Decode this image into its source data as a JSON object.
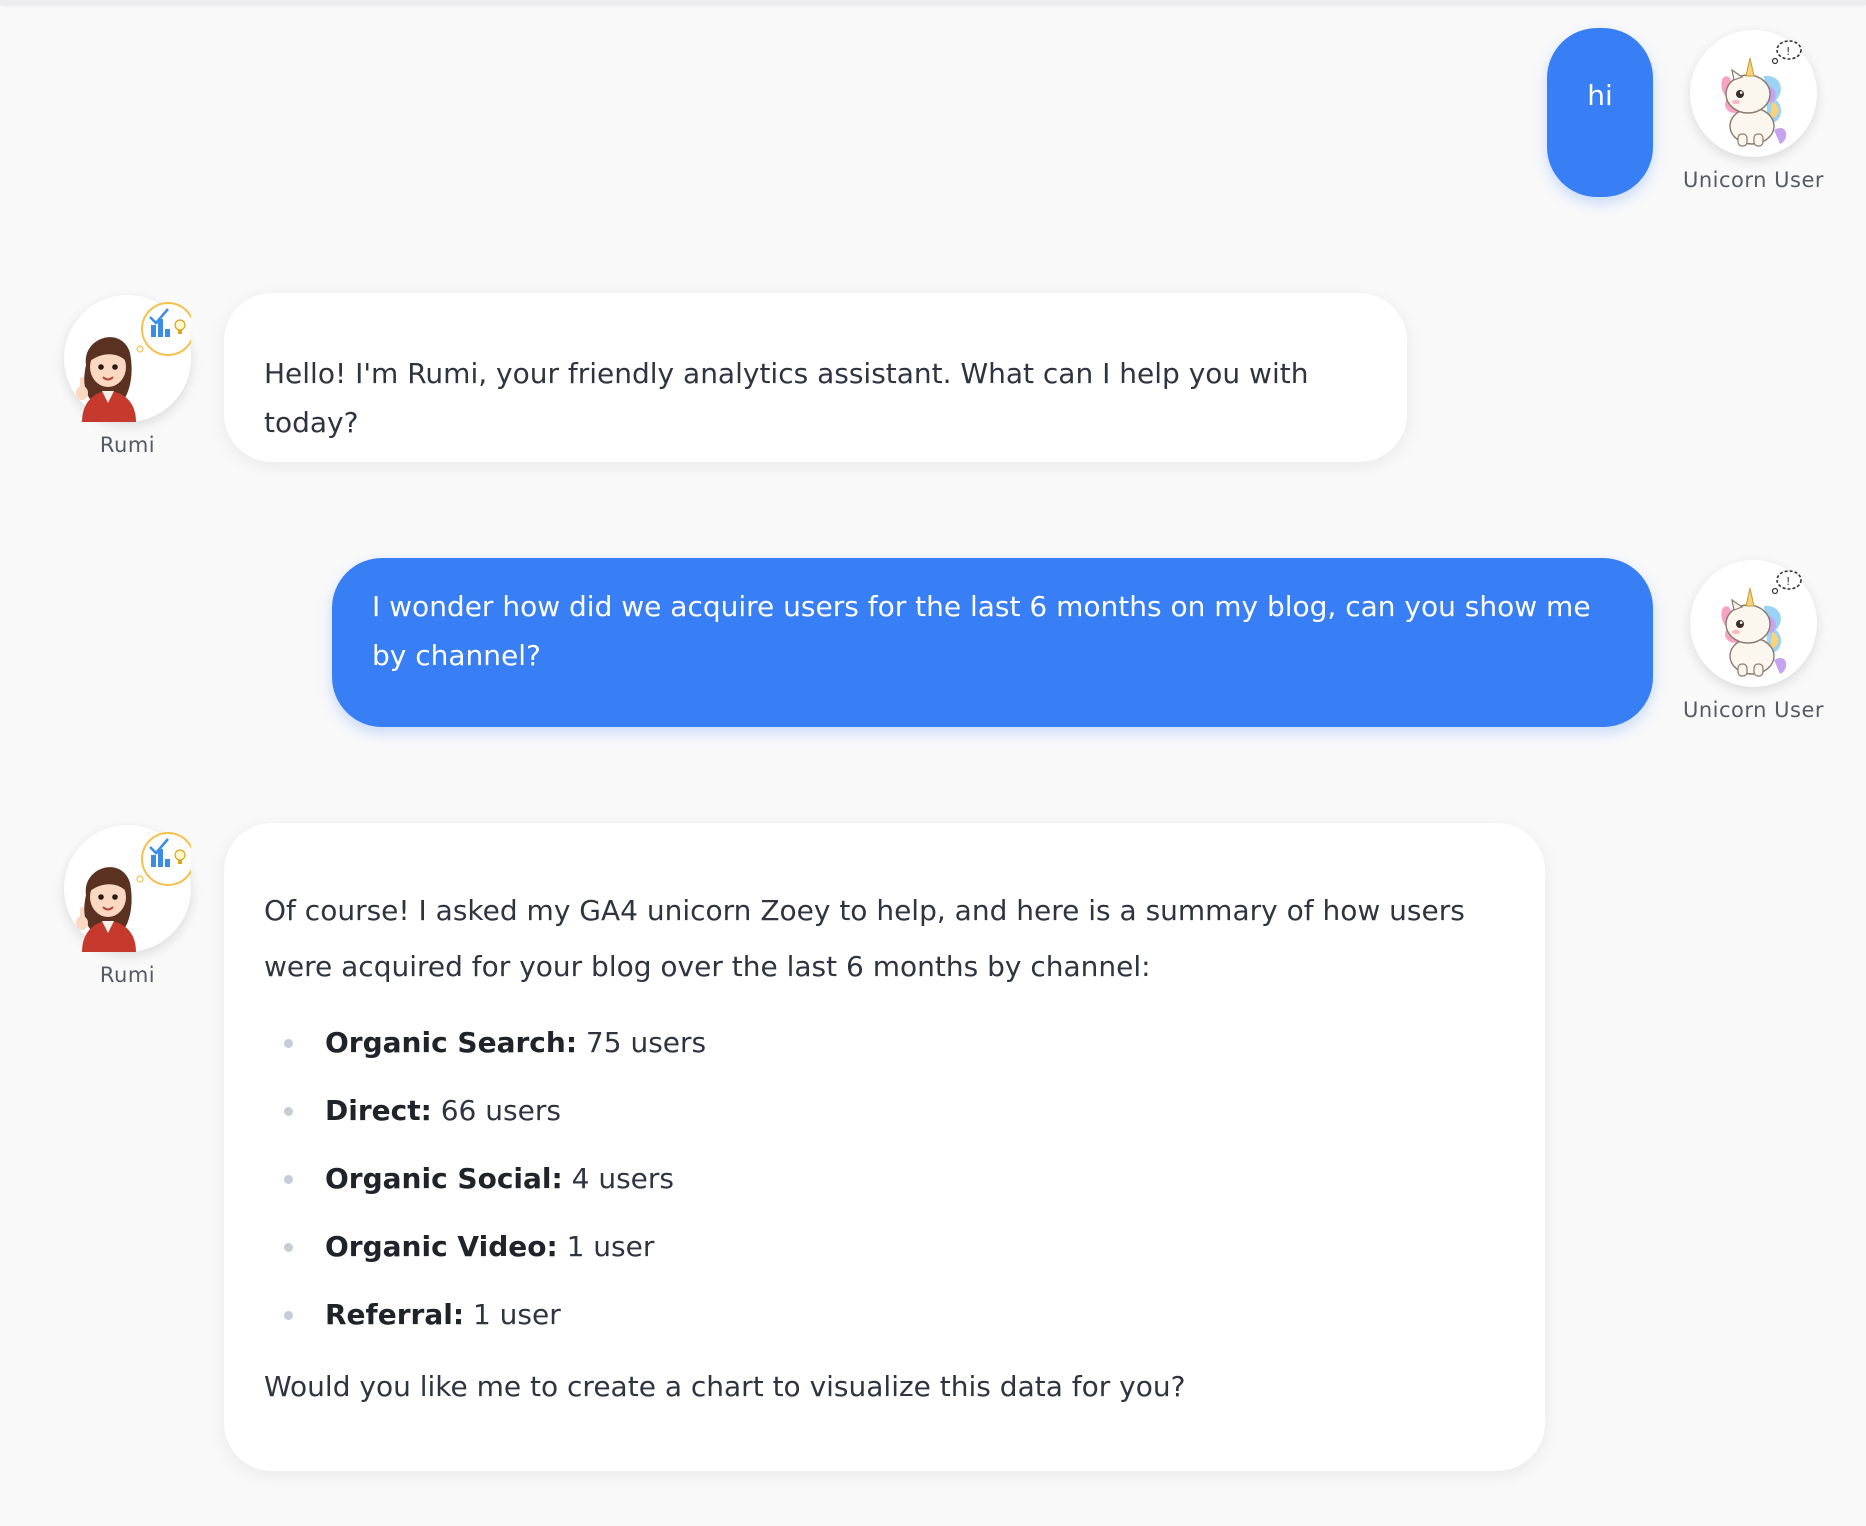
{
  "colors": {
    "user_bubble": "#387ef5",
    "bot_bubble": "#ffffff",
    "background": "#f9f9fa",
    "text": "#2f3440"
  },
  "user": {
    "name": "Unicorn User",
    "avatar_icon": "unicorn-avatar-icon"
  },
  "bot": {
    "name": "Rumi",
    "avatar_icon": "rumi-avatar-icon"
  },
  "messages": [
    {
      "role": "user",
      "text": "hi"
    },
    {
      "role": "bot",
      "text": "Hello! I'm Rumi, your friendly analytics assistant. What can I help you with today?"
    },
    {
      "role": "user",
      "text": "I wonder how did we acquire users for the last 6 months on my blog, can you show me by channel?"
    },
    {
      "role": "bot",
      "intro": "Of course! I asked my GA4 unicorn Zoey to help, and here is a summary of how users were acquired for your blog over the last 6 months by channel:",
      "items": [
        {
          "label": "Organic Search:",
          "value": "75 users"
        },
        {
          "label": "Direct:",
          "value": "66 users"
        },
        {
          "label": "Organic Social:",
          "value": "4 users"
        },
        {
          "label": "Organic Video:",
          "value": "1 user"
        },
        {
          "label": "Referral:",
          "value": "1 user"
        }
      ],
      "closing": "Would you like me to create a chart to visualize this data for you?"
    }
  ]
}
